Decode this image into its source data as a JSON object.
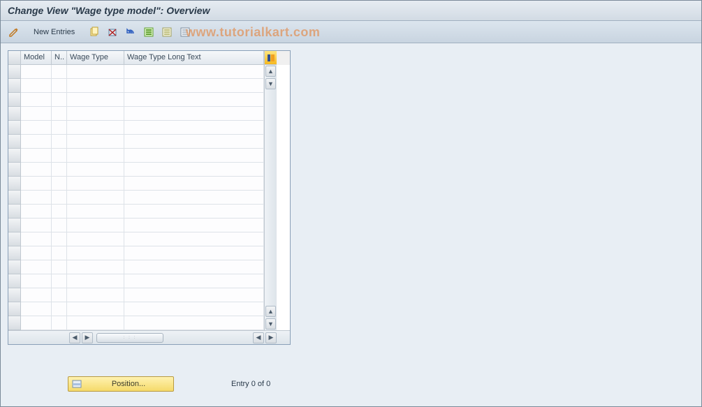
{
  "title": "Change View \"Wage type model\": Overview",
  "toolbar": {
    "new_entries_label": "New Entries"
  },
  "watermark": "www.tutorialkart.com",
  "table": {
    "columns": {
      "model": "Model",
      "n": "N..",
      "wage_type": "Wage Type",
      "wage_type_long": "Wage Type Long Text"
    },
    "row_count": 19
  },
  "footer": {
    "position_label": "Position...",
    "entry_status": "Entry 0 of 0"
  }
}
